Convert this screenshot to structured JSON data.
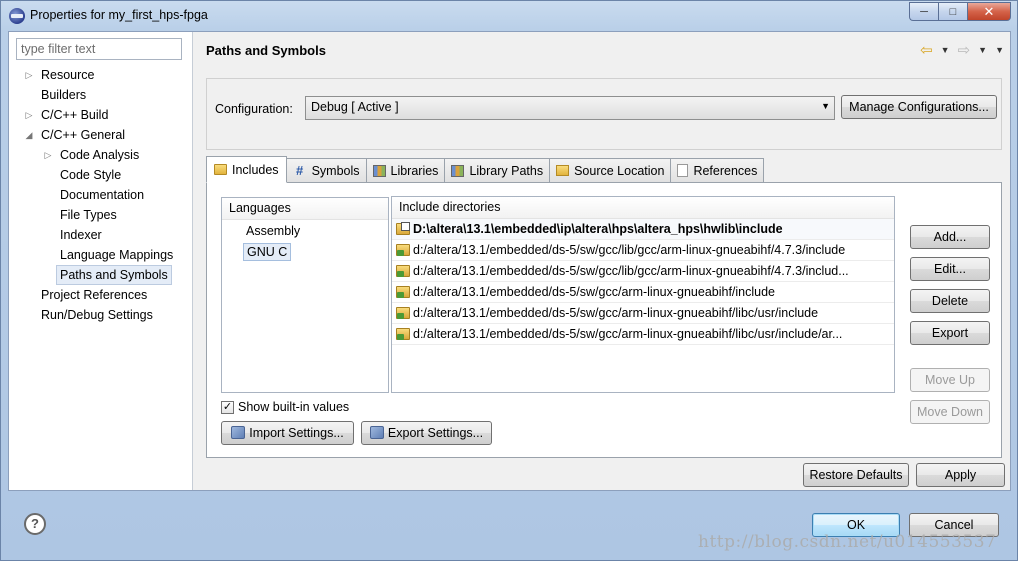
{
  "window": {
    "title": "Properties for my_first_hps-fpga",
    "controls": {
      "minimize": "─",
      "maximize": "□",
      "close": "✕"
    }
  },
  "sidebar": {
    "filter_placeholder": "type filter text",
    "items": [
      {
        "label": "Resource",
        "level": 0,
        "expander": "▷"
      },
      {
        "label": "Builders",
        "level": 0,
        "expander": ""
      },
      {
        "label": "C/C++ Build",
        "level": 0,
        "expander": "▷"
      },
      {
        "label": "C/C++ General",
        "level": 0,
        "expander": "◢"
      },
      {
        "label": "Code Analysis",
        "level": 1,
        "expander": "▷"
      },
      {
        "label": "Code Style",
        "level": 1,
        "expander": ""
      },
      {
        "label": "Documentation",
        "level": 1,
        "expander": ""
      },
      {
        "label": "File Types",
        "level": 1,
        "expander": ""
      },
      {
        "label": "Indexer",
        "level": 1,
        "expander": ""
      },
      {
        "label": "Language Mappings",
        "level": 1,
        "expander": ""
      },
      {
        "label": "Paths and Symbols",
        "level": 1,
        "expander": "",
        "selected": true
      },
      {
        "label": "Project References",
        "level": 0,
        "expander": ""
      },
      {
        "label": "Run/Debug Settings",
        "level": 0,
        "expander": ""
      }
    ]
  },
  "page": {
    "title": "Paths and Symbols",
    "nav": {
      "back": "⇦",
      "forward": "⇨",
      "dropdown": "▼",
      "menu": "▼"
    }
  },
  "configuration": {
    "label": "Configuration:",
    "value": "Debug  [ Active ]",
    "dropdown_glyph": "▼",
    "manage_button": "Manage Configurations..."
  },
  "tabs": [
    {
      "label": "Includes",
      "icon": "includes-folder-icon",
      "active": true
    },
    {
      "label": "Symbols",
      "icon": "hash-icon"
    },
    {
      "label": "Libraries",
      "icon": "libraries-icon"
    },
    {
      "label": "Library Paths",
      "icon": "library-paths-icon"
    },
    {
      "label": "Source Location",
      "icon": "source-location-icon"
    },
    {
      "label": "References",
      "icon": "references-icon"
    }
  ],
  "languages": {
    "header": "Languages",
    "items": [
      "Assembly",
      "GNU C"
    ],
    "selected": "GNU C"
  },
  "includes": {
    "header": "Include directories",
    "rows": [
      "D:\\altera\\13.1\\embedded\\ip\\altera\\hps\\altera_hps\\hwlib\\include",
      "d:/altera/13.1/embedded/ds-5/sw/gcc/lib/gcc/arm-linux-gnueabihf/4.7.3/include",
      "d:/altera/13.1/embedded/ds-5/sw/gcc/lib/gcc/arm-linux-gnueabihf/4.7.3/includ...",
      "d:/altera/13.1/embedded/ds-5/sw/gcc/arm-linux-gnueabihf/include",
      "d:/altera/13.1/embedded/ds-5/sw/gcc/arm-linux-gnueabihf/libc/usr/include",
      "d:/altera/13.1/embedded/ds-5/sw/gcc/arm-linux-gnueabihf/libc/usr/include/ar..."
    ]
  },
  "side_buttons": {
    "add": "Add...",
    "edit": "Edit...",
    "delete": "Delete",
    "export": "Export",
    "move_up": "Move Up",
    "move_down": "Move Down"
  },
  "show_builtin": {
    "label": "Show built-in values",
    "checked": true,
    "mark": "✓"
  },
  "import_settings": "Import Settings...",
  "export_settings": "Export Settings...",
  "restore_defaults": "Restore Defaults",
  "apply": "Apply",
  "ok": "OK",
  "cancel": "Cancel",
  "help_glyph": "?",
  "watermark": "http://blog.csdn.net/u014553537"
}
